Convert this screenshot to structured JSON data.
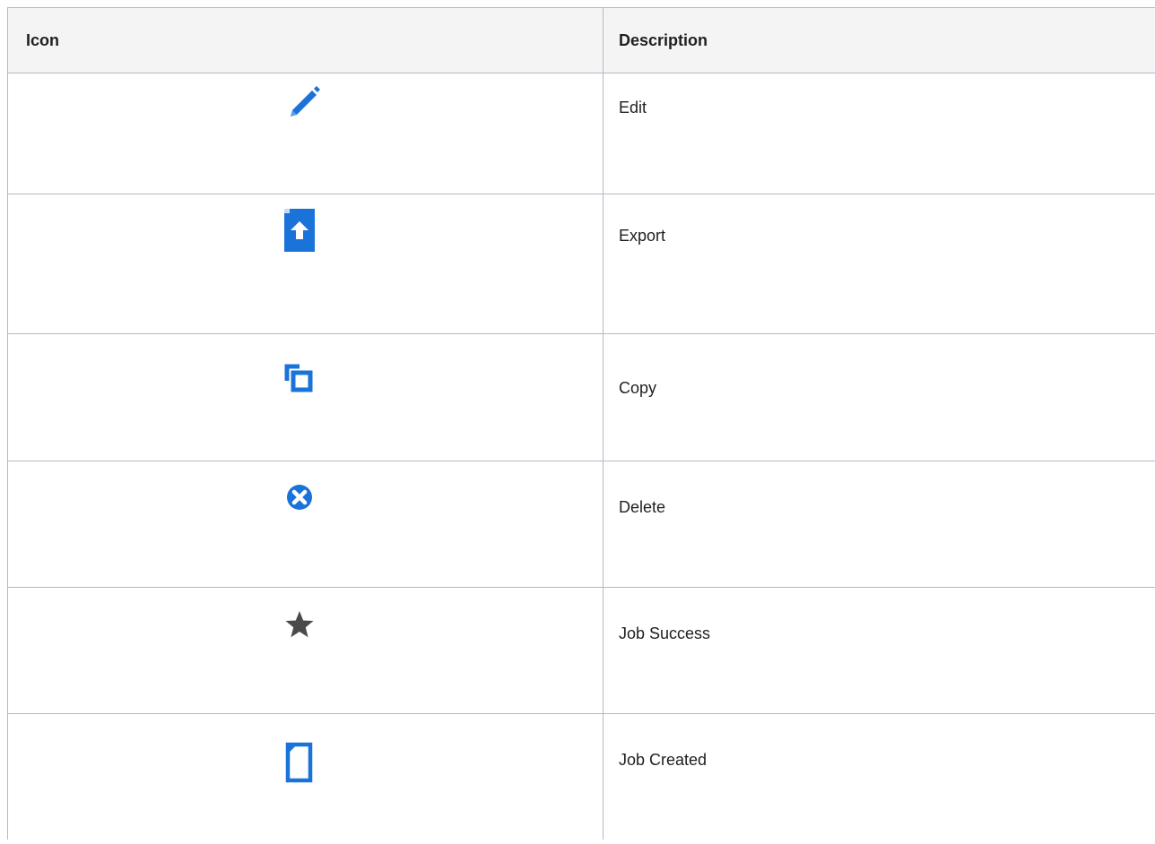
{
  "table": {
    "headers": {
      "icon": "Icon",
      "description": "Description"
    },
    "rows": [
      {
        "icon": "pencil-edit-icon",
        "description": "Edit"
      },
      {
        "icon": "export-upload-icon",
        "description": "Export"
      },
      {
        "icon": "copy-icon",
        "description": "Copy"
      },
      {
        "icon": "delete-circle-x-icon",
        "description": "Delete"
      },
      {
        "icon": "star-icon",
        "description": "Job Success"
      },
      {
        "icon": "document-icon",
        "description": "Job Created"
      }
    ]
  },
  "colors": {
    "border": "#b9b6c4",
    "header_bg": "#f4f4f4",
    "icon_blue": "#1a73d9",
    "star_gray": "#4a4a4a"
  }
}
